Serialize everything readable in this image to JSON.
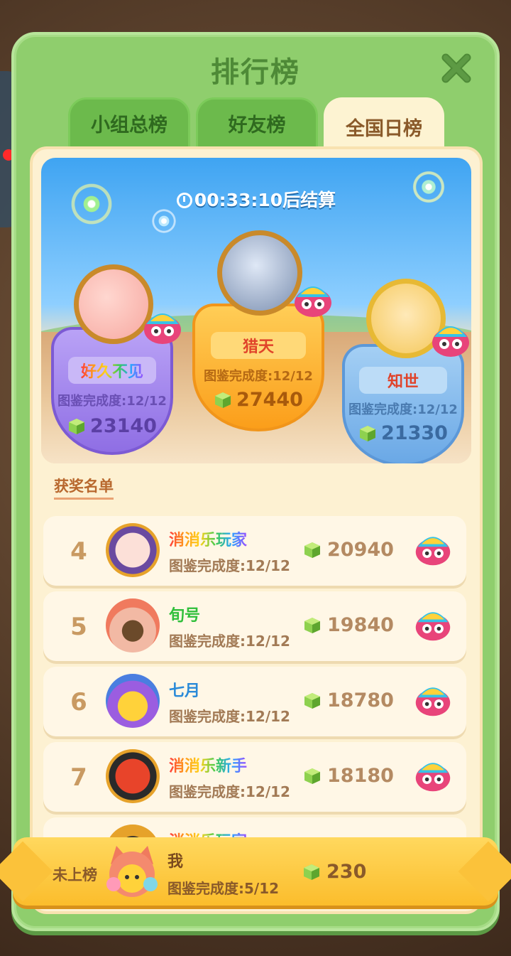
{
  "title": "排行榜",
  "tabs": [
    {
      "label": "小组总榜",
      "active": false
    },
    {
      "label": "好友榜",
      "active": false
    },
    {
      "label": "全国日榜",
      "active": true
    }
  ],
  "timer": {
    "time": "00:33:10",
    "suffix": "后结算"
  },
  "podium": {
    "first": {
      "name": "猎天",
      "progress": "图鉴完成度:12/12",
      "score": "27440"
    },
    "second": {
      "name": "好久不见",
      "progress": "图鉴完成度:12/12",
      "score": "23140"
    },
    "third": {
      "name": "知世",
      "progress": "图鉴完成度:12/12",
      "score": "21330"
    }
  },
  "award_list_title": "获奖名单",
  "rows": [
    {
      "rank": "4",
      "name": "消消乐玩家",
      "progress": "图鉴完成度:12/12",
      "score": "20940"
    },
    {
      "rank": "5",
      "name": "旬号",
      "progress": "图鉴完成度:12/12",
      "score": "19840"
    },
    {
      "rank": "6",
      "name": "七月",
      "progress": "图鉴完成度:12/12",
      "score": "18780"
    },
    {
      "rank": "7",
      "name": "消消乐新手",
      "progress": "图鉴完成度:12/12",
      "score": "18180"
    },
    {
      "rank": "",
      "name": "消消乐玩家",
      "progress": "",
      "score": ""
    }
  ],
  "self": {
    "rank_text": "未上榜",
    "name": "我",
    "progress": "图鉴完成度:5/12",
    "score": "230"
  },
  "colors": {
    "panel_green": "#8fce6d",
    "inner_cream": "#fdf1d2",
    "first_orange": "#fbb12c",
    "second_purple": "#a98bf0",
    "third_blue": "#7ab6ec",
    "self_yellow": "#fbbd2c"
  }
}
